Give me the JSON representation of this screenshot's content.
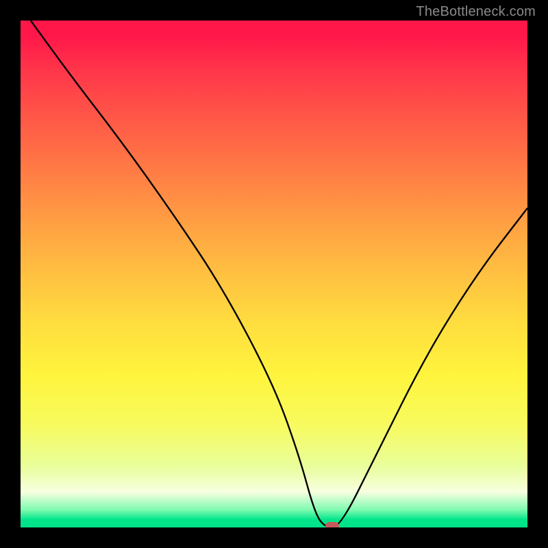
{
  "watermark": "TheBottleneck.com",
  "chart_data": {
    "type": "line",
    "title": "",
    "xlabel": "",
    "ylabel": "",
    "xlim": [
      0,
      100
    ],
    "ylim": [
      0,
      100
    ],
    "x": [
      2,
      10,
      20,
      30,
      40,
      50,
      55,
      58,
      60,
      63,
      70,
      80,
      90,
      100
    ],
    "values": [
      100,
      89,
      76,
      62,
      47,
      28,
      14,
      3,
      0,
      0,
      14,
      34,
      50,
      63
    ],
    "min_marker": {
      "x": 61.5,
      "y": 0
    },
    "gradient_stops": [
      {
        "pct": 0,
        "color": "#ff1749"
      },
      {
        "pct": 50,
        "color": "#ffc041"
      },
      {
        "pct": 80,
        "color": "#f7fb60"
      },
      {
        "pct": 97,
        "color": "#7ffbb0"
      },
      {
        "pct": 100,
        "color": "#00e58a"
      }
    ]
  }
}
